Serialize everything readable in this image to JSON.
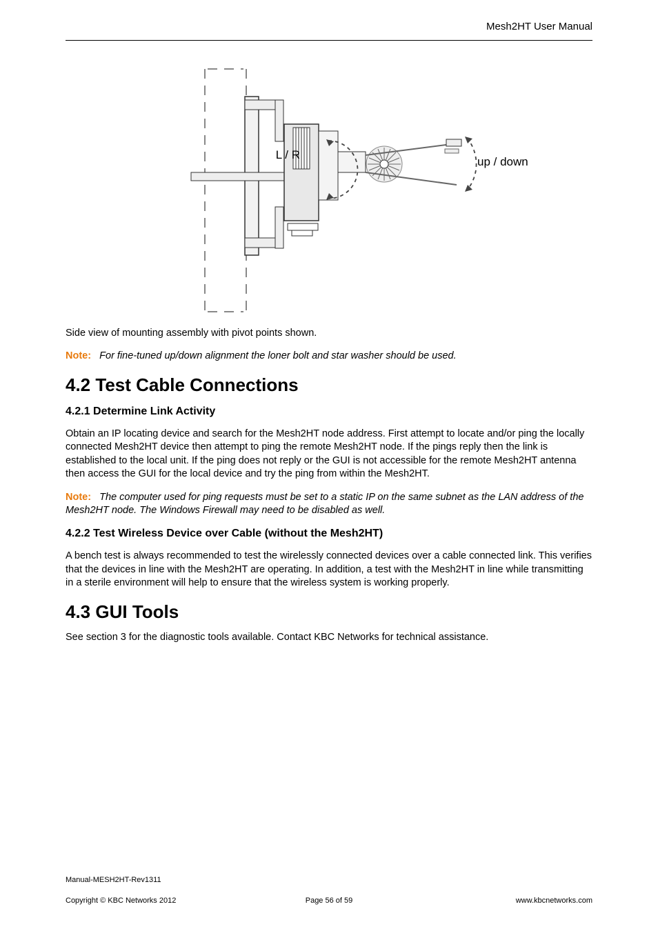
{
  "header": {
    "title": "Mesh2HT User Manual"
  },
  "figure": {
    "label_lr": "L / R",
    "label_updown": "up / down",
    "caption": "Side view of mounting assembly with pivot points shown."
  },
  "note1": {
    "label": "Note:",
    "text": "For fine-tuned up/down alignment the loner bolt and star washer should be used."
  },
  "sections": {
    "s42": {
      "heading": "4.2  Test Cable Connections",
      "s421": {
        "heading": "4.2.1 Determine Link Activity",
        "p1": "Obtain an IP locating device and search for the Mesh2HT node address. First attempt to locate and/or ping the locally connected Mesh2HT device then attempt to ping the remote Mesh2HT node. If the pings reply then the link is established to the local unit. If the ping does not reply or the GUI is not accessible for the remote Mesh2HT antenna then access the GUI for the local device and try the ping from within the Mesh2HT.",
        "note": {
          "label": "Note:",
          "text": "The computer used for ping requests must be set to a static IP on the same subnet as the LAN address of the Mesh2HT node. The Windows Firewall may need to be disabled as well."
        }
      },
      "s422": {
        "heading": "4.2.2 Test Wireless Device over Cable (without the Mesh2HT)",
        "p1": "A bench test is always recommended to test the wirelessly connected devices over a cable connected link. This verifies that the devices in line with the Mesh2HT are operating. In addition, a test with the Mesh2HT in line while transmitting in a sterile environment will help to ensure that the wireless system is working properly."
      }
    },
    "s43": {
      "heading": "4.3  GUI Tools",
      "p1": "See section 3 for the diagnostic tools available. Contact KBC Networks for technical assistance."
    }
  },
  "footer": {
    "line1": "Manual-MESH2HT-Rev1311",
    "left": "Copyright © KBC Networks 2012",
    "center": "Page 56 of 59",
    "right": "www.kbcnetworks.com"
  }
}
